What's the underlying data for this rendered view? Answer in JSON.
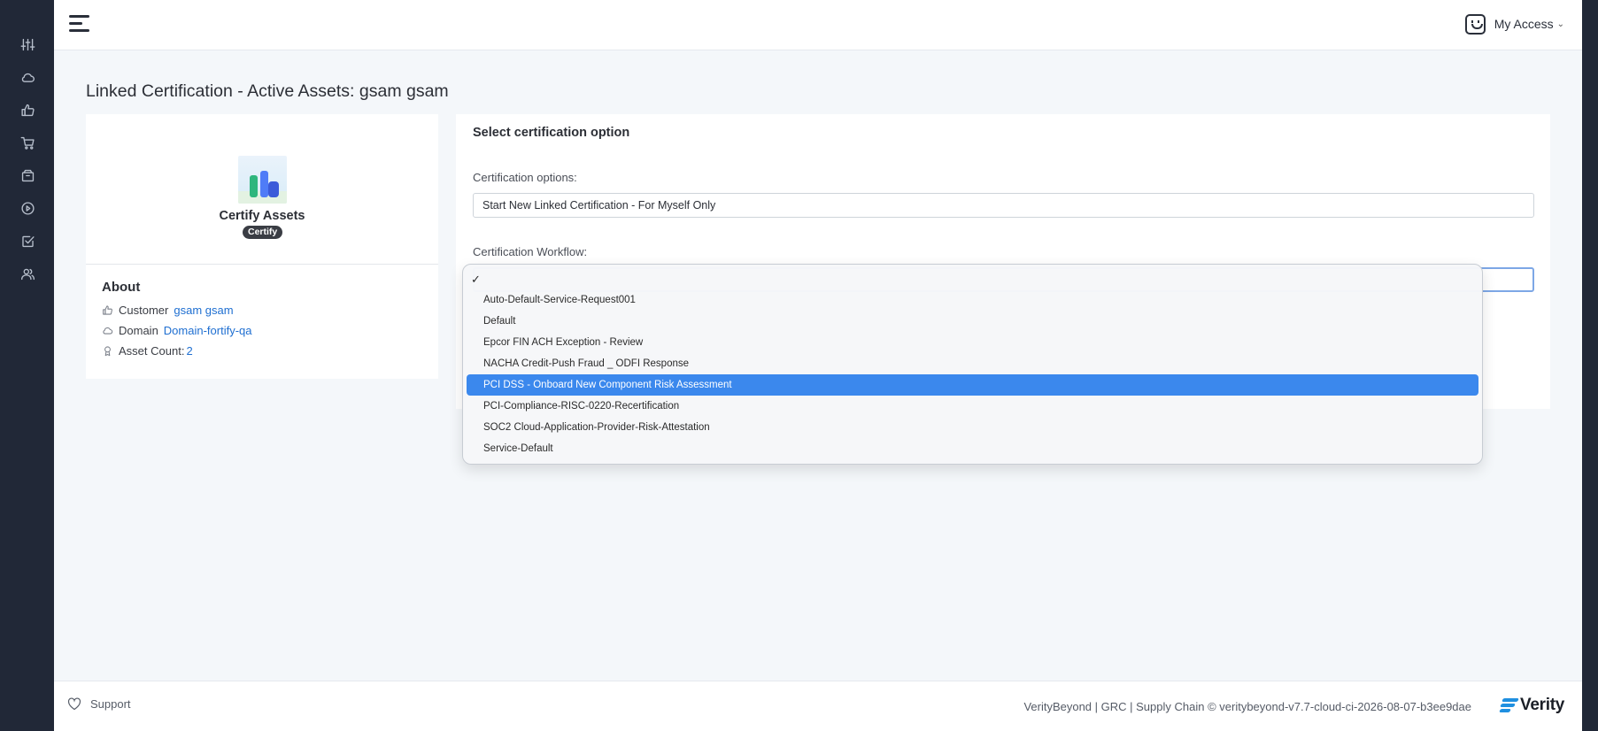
{
  "sidebar": {
    "icons": [
      "sliders-icon",
      "cloud-icon",
      "thumbs-up-icon",
      "cart-icon",
      "box-icon",
      "play-circle-icon",
      "check-square-icon",
      "users-icon"
    ]
  },
  "header": {
    "account_label": "My Access",
    "account_chevron": "⌄"
  },
  "page": {
    "title": "Linked Certification - Active Assets: gsam gsam"
  },
  "certificate": {
    "name": "Certify Assets",
    "badge": "Certify"
  },
  "about": {
    "title": "About",
    "customer_label": "Customer",
    "customer_value": "gsam gsam",
    "domain_label": "Domain",
    "domain_value": "Domain-fortify-qa",
    "asset_count_label": "Asset Count:",
    "asset_count_value": "2"
  },
  "form": {
    "section_title": "Select certification option",
    "options_label": "Certification options:",
    "options_value": "Start New Linked Certification - For Myself Only",
    "workflow_label": "Certification Workflow:"
  },
  "workflow_dropdown": {
    "check_mark": "✓",
    "options": [
      "Auto-Default-Service-Request001",
      "Default",
      "Epcor FIN ACH Exception - Review",
      "NACHA Credit-Push Fraud _ ODFI Response",
      "PCI DSS - Onboard New Component Risk Assessment",
      "PCI-Compliance-RISC-0220-Recertification",
      "SOC2 Cloud-Application-Provider-Risk-Attestation",
      "Service-Default"
    ],
    "highlighted_option": "PCI DSS - Onboard New Component Risk Assessment"
  },
  "footer": {
    "support_label": "Support",
    "copyright": "VerityBeyond | GRC | Supply Chain © veritybeyond-v7.7-cloud-ci-2026-08-07-b3ee9dae",
    "brand_name": "Verity"
  },
  "colors": {
    "sidebar_bg": "#212837",
    "accent_blue": "#3b88ed",
    "link_blue": "#1f6fd1",
    "page_bg": "#f4f7fa"
  }
}
